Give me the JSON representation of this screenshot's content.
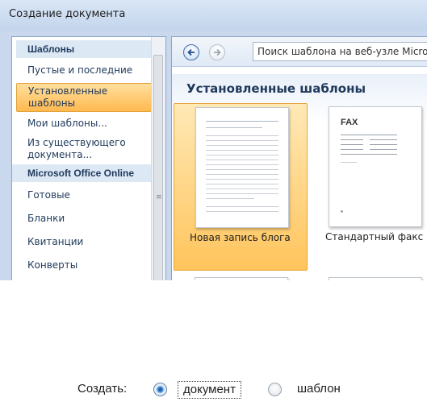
{
  "window": {
    "title": "Создание документа"
  },
  "sidebar": {
    "items": [
      {
        "label": "Шаблоны",
        "kind": "header"
      },
      {
        "label": "Пустые и последние",
        "kind": "item"
      },
      {
        "label": "Установленные шаблоны",
        "kind": "selected"
      },
      {
        "label": "Мои шаблоны...",
        "kind": "item"
      },
      {
        "label": "Из существующего документа...",
        "kind": "item"
      },
      {
        "label": "Microsoft Office Online",
        "kind": "header"
      },
      {
        "label": "Готовые",
        "kind": "item"
      },
      {
        "label": "Бланки",
        "kind": "item"
      },
      {
        "label": "Квитанции",
        "kind": "item"
      },
      {
        "label": "Конверты",
        "kind": "item"
      }
    ]
  },
  "toolbar": {
    "back_icon": "arrow-left-icon",
    "forward_icon": "arrow-right-icon",
    "search_placeholder": "Поиск шаблона на веб-узле Microsoft Office Online"
  },
  "main": {
    "section_title": "Установленные шаблоны",
    "templates": [
      {
        "label": "Новая запись блога",
        "selected": true
      },
      {
        "label": "Стандартный факс",
        "selected": false,
        "page_heading": "FAX"
      }
    ]
  },
  "create": {
    "label": "Создать:",
    "options": [
      {
        "label": "документ",
        "checked": true
      },
      {
        "label": "шаблон",
        "checked": false
      }
    ]
  },
  "colors": {
    "accent": "#ffc45c",
    "header_text": "#1e395b",
    "title_bar": "#c9d8ec"
  }
}
